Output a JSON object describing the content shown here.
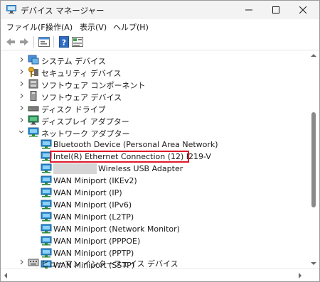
{
  "window": {
    "title": "デバイス マネージャー",
    "icon": "device-manager-icon"
  },
  "titlebar_buttons": {
    "minimize": "minimize-icon",
    "maximize": "maximize-icon",
    "close": "close-icon"
  },
  "menu": [
    "ファイル(F)",
    "操作(A)",
    "表示(V)",
    "ヘルプ(H)"
  ],
  "toolbar": {
    "back": "back-arrow-icon",
    "forward": "forward-arrow-icon",
    "properties": "properties-icon",
    "help": "help-icon",
    "view": "view-icon"
  },
  "tree": {
    "categories_top": [
      {
        "label": "システム デバイス",
        "icon": "system-device-icon",
        "expanded": false
      },
      {
        "label": "セキュリティ デバイス",
        "icon": "security-key-icon",
        "expanded": false
      },
      {
        "label": "ソフトウェア コンポーネント",
        "icon": "software-component-icon",
        "expanded": false
      },
      {
        "label": "ソフトウェア デバイス",
        "icon": "software-device-icon",
        "expanded": false
      },
      {
        "label": "ディスク ドライブ",
        "icon": "disk-drive-icon",
        "expanded": false
      },
      {
        "label": "ディスプレイ アダプター",
        "icon": "display-adapter-icon",
        "expanded": false
      },
      {
        "label": "ネットワーク アダプター",
        "icon": "network-adapter-icon",
        "expanded": true
      }
    ],
    "network_adapters": [
      {
        "label": "Bluetooth Device (Personal Area Network)",
        "highlighted": false,
        "redacted_prefix": false
      },
      {
        "label": "Intel(R) Ethernet Connection (12) I219-V",
        "highlighted": true,
        "redacted_prefix": false
      },
      {
        "label": "Wireless USB Adapter",
        "highlighted": false,
        "redacted_prefix": true
      },
      {
        "label": "WAN Miniport (IKEv2)",
        "highlighted": false,
        "redacted_prefix": false
      },
      {
        "label": "WAN Miniport (IP)",
        "highlighted": false,
        "redacted_prefix": false
      },
      {
        "label": "WAN Miniport (IPv6)",
        "highlighted": false,
        "redacted_prefix": false
      },
      {
        "label": "WAN Miniport (L2TP)",
        "highlighted": false,
        "redacted_prefix": false
      },
      {
        "label": "WAN Miniport (Network Monitor)",
        "highlighted": false,
        "redacted_prefix": false
      },
      {
        "label": "WAN Miniport (PPPOE)",
        "highlighted": false,
        "redacted_prefix": false
      },
      {
        "label": "WAN Miniport (PPTP)",
        "highlighted": false,
        "redacted_prefix": false
      },
      {
        "label": "WAN Miniport (SSTP)",
        "highlighted": false,
        "redacted_prefix": false
      }
    ],
    "categories_bottom": [
      {
        "label": "ヒューマン インターフェイス デバイス",
        "icon": "hid-icon",
        "expanded": false
      }
    ]
  },
  "colors": {
    "highlight_border": "#e0192a",
    "network_icon": "#2a8fd6",
    "redaction": "#d6d6d6"
  }
}
